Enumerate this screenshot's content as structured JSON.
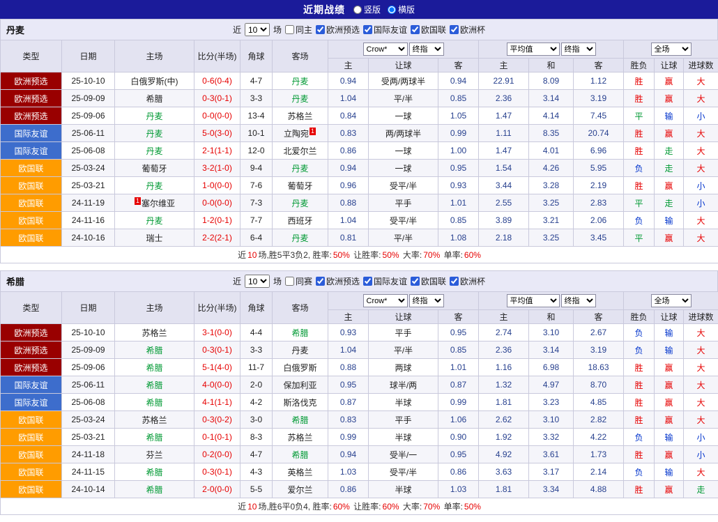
{
  "top_bar": {
    "title": "近期战绩",
    "layout_options": [
      {
        "label": "竖版",
        "selected": false
      },
      {
        "label": "横版",
        "selected": true
      }
    ]
  },
  "colors": {
    "accent": "#1b1b9a",
    "focus_team": "#009933",
    "score": "#e60000",
    "odds": "#28418f",
    "type": {
      "欧洲预选": "#990000",
      "国际友谊": "#3d6dcc",
      "欧国联": "#ff9c00"
    },
    "result": {
      "r": "#e60000",
      "g": "#009933",
      "b": "#0033cc"
    }
  },
  "table_header": {
    "static_cols": [
      "类型",
      "日期",
      "主场",
      "比分(半场)",
      "角球",
      "客场"
    ],
    "odds_group": {
      "bookmaker_select": "Crow*",
      "stage_select": "终指",
      "cols": [
        "主",
        "让球",
        "客"
      ]
    },
    "avg_group": {
      "avg_select": "平均值",
      "stage_select": "终指",
      "cols": [
        "主",
        "和",
        "客"
      ]
    },
    "result_group": {
      "scope_select": "全场",
      "cols": [
        "胜负",
        "让球",
        "进球数"
      ]
    }
  },
  "sections": [
    {
      "id": "denmark",
      "team": "丹麦",
      "filter": {
        "near_label": "近",
        "count": "10",
        "games_label": "场",
        "same_label": "同主",
        "same_checked": false,
        "competitions": [
          {
            "label": "欧洲预选",
            "checked": true
          },
          {
            "label": "国际友谊",
            "checked": true
          },
          {
            "label": "欧国联",
            "checked": true
          },
          {
            "label": "欧洲杯",
            "checked": true
          }
        ]
      },
      "rows": [
        {
          "type": "欧洲预选",
          "date": "25-10-10",
          "home": {
            "name": "白俄罗斯(中)",
            "focus": false
          },
          "score": "0-6(0-4)",
          "corner": "4-7",
          "away": {
            "name": "丹麦",
            "focus": true
          },
          "odds": [
            "0.94",
            "受两/两球半",
            "0.94"
          ],
          "avg": [
            "22.91",
            "8.09",
            "1.12"
          ],
          "results": [
            [
              "胜",
              "r"
            ],
            [
              "赢",
              "r"
            ],
            [
              "大",
              "r"
            ]
          ]
        },
        {
          "type": "欧洲预选",
          "date": "25-09-09",
          "home": {
            "name": "希腊",
            "focus": false
          },
          "score": "0-3(0-1)",
          "corner": "3-3",
          "away": {
            "name": "丹麦",
            "focus": true
          },
          "odds": [
            "1.04",
            "平/半",
            "0.85"
          ],
          "avg": [
            "2.36",
            "3.14",
            "3.19"
          ],
          "results": [
            [
              "胜",
              "r"
            ],
            [
              "赢",
              "r"
            ],
            [
              "大",
              "r"
            ]
          ]
        },
        {
          "type": "欧洲预选",
          "date": "25-09-06",
          "home": {
            "name": "丹麦",
            "focus": true
          },
          "score": "0-0(0-0)",
          "corner": "13-4",
          "away": {
            "name": "苏格兰",
            "focus": false
          },
          "odds": [
            "0.84",
            "一球",
            "1.05"
          ],
          "avg": [
            "1.47",
            "4.14",
            "7.45"
          ],
          "results": [
            [
              "平",
              "g"
            ],
            [
              "输",
              "b"
            ],
            [
              "小",
              "b"
            ]
          ]
        },
        {
          "type": "国际友谊",
          "date": "25-06-11",
          "home": {
            "name": "丹麦",
            "focus": true
          },
          "score": "5-0(3-0)",
          "corner": "10-1",
          "away": {
            "name": "立陶宛",
            "focus": false,
            "badge": "1",
            "badge_pos": "post"
          },
          "odds": [
            "0.83",
            "两/两球半",
            "0.99"
          ],
          "avg": [
            "1.11",
            "8.35",
            "20.74"
          ],
          "results": [
            [
              "胜",
              "r"
            ],
            [
              "赢",
              "r"
            ],
            [
              "大",
              "r"
            ]
          ]
        },
        {
          "type": "国际友谊",
          "date": "25-06-08",
          "home": {
            "name": "丹麦",
            "focus": true
          },
          "score": "2-1(1-1)",
          "corner": "12-0",
          "away": {
            "name": "北爱尔兰",
            "focus": false
          },
          "odds": [
            "0.86",
            "一球",
            "1.00"
          ],
          "avg": [
            "1.47",
            "4.01",
            "6.96"
          ],
          "results": [
            [
              "胜",
              "r"
            ],
            [
              "走",
              "g"
            ],
            [
              "大",
              "r"
            ]
          ]
        },
        {
          "type": "欧国联",
          "date": "25-03-24",
          "home": {
            "name": "葡萄牙",
            "focus": false
          },
          "score": "3-2(1-0)",
          "corner": "9-4",
          "away": {
            "name": "丹麦",
            "focus": true
          },
          "odds": [
            "0.94",
            "一球",
            "0.95"
          ],
          "avg": [
            "1.54",
            "4.26",
            "5.95"
          ],
          "results": [
            [
              "负",
              "b"
            ],
            [
              "走",
              "g"
            ],
            [
              "大",
              "r"
            ]
          ]
        },
        {
          "type": "欧国联",
          "date": "25-03-21",
          "home": {
            "name": "丹麦",
            "focus": true
          },
          "score": "1-0(0-0)",
          "corner": "7-6",
          "away": {
            "name": "葡萄牙",
            "focus": false
          },
          "odds": [
            "0.96",
            "受平/半",
            "0.93"
          ],
          "avg": [
            "3.44",
            "3.28",
            "2.19"
          ],
          "results": [
            [
              "胜",
              "r"
            ],
            [
              "赢",
              "r"
            ],
            [
              "小",
              "b"
            ]
          ]
        },
        {
          "type": "欧国联",
          "date": "24-11-19",
          "home": {
            "name": "塞尔维亚",
            "focus": false,
            "badge": "1",
            "badge_pos": "pre"
          },
          "score": "0-0(0-0)",
          "corner": "7-3",
          "away": {
            "name": "丹麦",
            "focus": true
          },
          "odds": [
            "0.88",
            "平手",
            "1.01"
          ],
          "avg": [
            "2.55",
            "3.25",
            "2.83"
          ],
          "results": [
            [
              "平",
              "g"
            ],
            [
              "走",
              "g"
            ],
            [
              "小",
              "b"
            ]
          ]
        },
        {
          "type": "欧国联",
          "date": "24-11-16",
          "home": {
            "name": "丹麦",
            "focus": true
          },
          "score": "1-2(0-1)",
          "corner": "7-7",
          "away": {
            "name": "西班牙",
            "focus": false
          },
          "odds": [
            "1.04",
            "受平/半",
            "0.85"
          ],
          "avg": [
            "3.89",
            "3.21",
            "2.06"
          ],
          "results": [
            [
              "负",
              "b"
            ],
            [
              "输",
              "b"
            ],
            [
              "大",
              "r"
            ]
          ]
        },
        {
          "type": "欧国联",
          "date": "24-10-16",
          "home": {
            "name": "瑞士",
            "focus": false
          },
          "score": "2-2(2-1)",
          "corner": "6-4",
          "away": {
            "name": "丹麦",
            "focus": true
          },
          "odds": [
            "0.81",
            "平/半",
            "1.08"
          ],
          "avg": [
            "2.18",
            "3.25",
            "3.45"
          ],
          "results": [
            [
              "平",
              "g"
            ],
            [
              "赢",
              "r"
            ],
            [
              "大",
              "r"
            ]
          ]
        }
      ],
      "summary": [
        [
          "近",
          "k"
        ],
        [
          "10",
          "r"
        ],
        [
          "场,胜5平3负2, 胜率:",
          "k"
        ],
        [
          "50%",
          "r"
        ],
        [
          " 让胜率:",
          "k"
        ],
        [
          "50%",
          "r"
        ],
        [
          " 大率:",
          "k"
        ],
        [
          "70%",
          "r"
        ],
        [
          " 单率:",
          "k"
        ],
        [
          "60%",
          "r"
        ]
      ]
    },
    {
      "id": "greece",
      "team": "希腊",
      "filter": {
        "near_label": "近",
        "count": "10",
        "games_label": "场",
        "same_label": "同赛",
        "same_checked": false,
        "competitions": [
          {
            "label": "欧洲预选",
            "checked": true
          },
          {
            "label": "国际友谊",
            "checked": true
          },
          {
            "label": "欧国联",
            "checked": true
          },
          {
            "label": "欧洲杯",
            "checked": true
          }
        ]
      },
      "rows": [
        {
          "type": "欧洲预选",
          "date": "25-10-10",
          "home": {
            "name": "苏格兰",
            "focus": false
          },
          "score": "3-1(0-0)",
          "corner": "4-4",
          "away": {
            "name": "希腊",
            "focus": true
          },
          "odds": [
            "0.93",
            "平手",
            "0.95"
          ],
          "avg": [
            "2.74",
            "3.10",
            "2.67"
          ],
          "results": [
            [
              "负",
              "b"
            ],
            [
              "输",
              "b"
            ],
            [
              "大",
              "r"
            ]
          ]
        },
        {
          "type": "欧洲预选",
          "date": "25-09-09",
          "home": {
            "name": "希腊",
            "focus": true
          },
          "score": "0-3(0-1)",
          "corner": "3-3",
          "away": {
            "name": "丹麦",
            "focus": false
          },
          "odds": [
            "1.04",
            "平/半",
            "0.85"
          ],
          "avg": [
            "2.36",
            "3.14",
            "3.19"
          ],
          "results": [
            [
              "负",
              "b"
            ],
            [
              "输",
              "b"
            ],
            [
              "大",
              "r"
            ]
          ]
        },
        {
          "type": "欧洲预选",
          "date": "25-09-06",
          "home": {
            "name": "希腊",
            "focus": true
          },
          "score": "5-1(4-0)",
          "corner": "11-7",
          "away": {
            "name": "白俄罗斯",
            "focus": false
          },
          "odds": [
            "0.88",
            "两球",
            "1.01"
          ],
          "avg": [
            "1.16",
            "6.98",
            "18.63"
          ],
          "results": [
            [
              "胜",
              "r"
            ],
            [
              "赢",
              "r"
            ],
            [
              "大",
              "r"
            ]
          ]
        },
        {
          "type": "国际友谊",
          "date": "25-06-11",
          "home": {
            "name": "希腊",
            "focus": true
          },
          "score": "4-0(0-0)",
          "corner": "2-0",
          "away": {
            "name": "保加利亚",
            "focus": false
          },
          "odds": [
            "0.95",
            "球半/两",
            "0.87"
          ],
          "avg": [
            "1.32",
            "4.97",
            "8.70"
          ],
          "results": [
            [
              "胜",
              "r"
            ],
            [
              "赢",
              "r"
            ],
            [
              "大",
              "r"
            ]
          ]
        },
        {
          "type": "国际友谊",
          "date": "25-06-08",
          "home": {
            "name": "希腊",
            "focus": true
          },
          "score": "4-1(1-1)",
          "corner": "4-2",
          "away": {
            "name": "斯洛伐克",
            "focus": false
          },
          "odds": [
            "0.87",
            "半球",
            "0.99"
          ],
          "avg": [
            "1.81",
            "3.23",
            "4.85"
          ],
          "results": [
            [
              "胜",
              "r"
            ],
            [
              "赢",
              "r"
            ],
            [
              "大",
              "r"
            ]
          ]
        },
        {
          "type": "欧国联",
          "date": "25-03-24",
          "home": {
            "name": "苏格兰",
            "focus": false
          },
          "score": "0-3(0-2)",
          "corner": "3-0",
          "away": {
            "name": "希腊",
            "focus": true
          },
          "odds": [
            "0.83",
            "平手",
            "1.06"
          ],
          "avg": [
            "2.62",
            "3.10",
            "2.82"
          ],
          "results": [
            [
              "胜",
              "r"
            ],
            [
              "赢",
              "r"
            ],
            [
              "大",
              "r"
            ]
          ]
        },
        {
          "type": "欧国联",
          "date": "25-03-21",
          "home": {
            "name": "希腊",
            "focus": true
          },
          "score": "0-1(0-1)",
          "corner": "8-3",
          "away": {
            "name": "苏格兰",
            "focus": false
          },
          "odds": [
            "0.99",
            "半球",
            "0.90"
          ],
          "avg": [
            "1.92",
            "3.32",
            "4.22"
          ],
          "results": [
            [
              "负",
              "b"
            ],
            [
              "输",
              "b"
            ],
            [
              "小",
              "b"
            ]
          ]
        },
        {
          "type": "欧国联",
          "date": "24-11-18",
          "home": {
            "name": "芬兰",
            "focus": false
          },
          "score": "0-2(0-0)",
          "corner": "4-7",
          "away": {
            "name": "希腊",
            "focus": true
          },
          "odds": [
            "0.94",
            "受半/一",
            "0.95"
          ],
          "avg": [
            "4.92",
            "3.61",
            "1.73"
          ],
          "results": [
            [
              "胜",
              "r"
            ],
            [
              "赢",
              "r"
            ],
            [
              "小",
              "b"
            ]
          ]
        },
        {
          "type": "欧国联",
          "date": "24-11-15",
          "home": {
            "name": "希腊",
            "focus": true
          },
          "score": "0-3(0-1)",
          "corner": "4-3",
          "away": {
            "name": "英格兰",
            "focus": false
          },
          "odds": [
            "1.03",
            "受平/半",
            "0.86"
          ],
          "avg": [
            "3.63",
            "3.17",
            "2.14"
          ],
          "results": [
            [
              "负",
              "b"
            ],
            [
              "输",
              "b"
            ],
            [
              "大",
              "r"
            ]
          ]
        },
        {
          "type": "欧国联",
          "date": "24-10-14",
          "home": {
            "name": "希腊",
            "focus": true
          },
          "score": "2-0(0-0)",
          "corner": "5-5",
          "away": {
            "name": "爱尔兰",
            "focus": false
          },
          "odds": [
            "0.86",
            "半球",
            "1.03"
          ],
          "avg": [
            "1.81",
            "3.34",
            "4.88"
          ],
          "results": [
            [
              "胜",
              "r"
            ],
            [
              "赢",
              "r"
            ],
            [
              "走",
              "g"
            ]
          ]
        }
      ],
      "summary": [
        [
          "近",
          "k"
        ],
        [
          "10",
          "r"
        ],
        [
          "场,胜6平0负4, 胜率:",
          "k"
        ],
        [
          "60%",
          "r"
        ],
        [
          " 让胜率:",
          "k"
        ],
        [
          "60%",
          "r"
        ],
        [
          " 大率:",
          "k"
        ],
        [
          "70%",
          "r"
        ],
        [
          " 单率:",
          "k"
        ],
        [
          "50%",
          "r"
        ]
      ]
    }
  ]
}
